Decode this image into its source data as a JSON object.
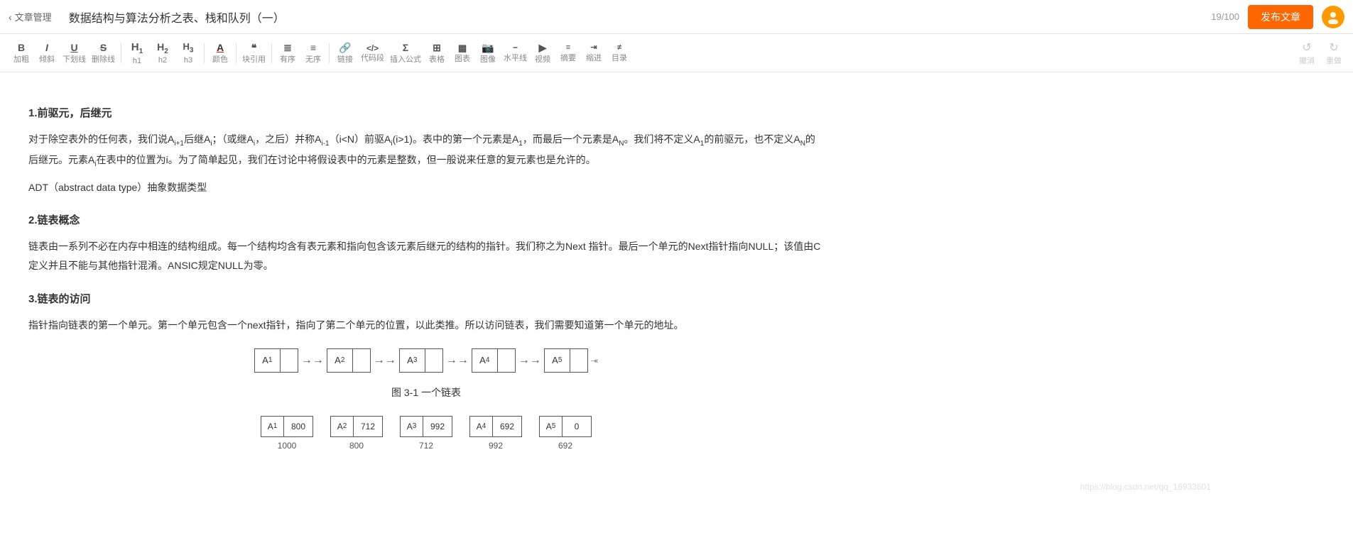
{
  "header": {
    "back_label": "文章管理",
    "title": "数据结构与算法分析之表、栈和队列（一）",
    "word_count": "19/100",
    "publish_label": "发布文章",
    "avatar_icon": "👤"
  },
  "toolbar": {
    "buttons": [
      {
        "id": "bold",
        "icon": "B",
        "label": "加粗",
        "style": "bold"
      },
      {
        "id": "italic",
        "icon": "I",
        "label": "倾斜",
        "style": "italic"
      },
      {
        "id": "underline",
        "icon": "U",
        "label": "下划线",
        "style": "underline"
      },
      {
        "id": "strikethrough",
        "icon": "S",
        "label": "删除线",
        "style": "strikethrough"
      },
      {
        "id": "h1",
        "icon": "H₁",
        "label": "h1",
        "style": "normal"
      },
      {
        "id": "h2",
        "icon": "H₂",
        "label": "h2",
        "style": "normal"
      },
      {
        "id": "h3",
        "icon": "H₃",
        "label": "h3",
        "style": "normal"
      },
      {
        "id": "color",
        "icon": "A",
        "label": "颜色",
        "style": "normal"
      },
      {
        "id": "blockquote",
        "icon": "❝",
        "label": "块引用",
        "style": "normal"
      },
      {
        "id": "ordered",
        "icon": "≡",
        "label": "有序",
        "style": "normal"
      },
      {
        "id": "unordered",
        "icon": "≡",
        "label": "无序",
        "style": "normal"
      },
      {
        "id": "link",
        "icon": "🔗",
        "label": "链接",
        "style": "normal"
      },
      {
        "id": "code",
        "icon": "</>",
        "label": "代码段",
        "style": "normal"
      },
      {
        "id": "formula",
        "icon": "Σ",
        "label": "插入公式",
        "style": "normal"
      },
      {
        "id": "table",
        "icon": "⊞",
        "label": "表格",
        "style": "normal"
      },
      {
        "id": "chart",
        "icon": "📊",
        "label": "图表",
        "style": "normal"
      },
      {
        "id": "image",
        "icon": "🖼",
        "label": "图像",
        "style": "normal"
      },
      {
        "id": "divider",
        "icon": "—",
        "label": "水平线",
        "style": "normal"
      },
      {
        "id": "video",
        "icon": "▶",
        "label": "视频",
        "style": "normal"
      },
      {
        "id": "summary",
        "icon": "≡",
        "label": "摘要",
        "style": "normal"
      },
      {
        "id": "indent",
        "icon": "→≡",
        "label": "缩进",
        "style": "normal"
      },
      {
        "id": "toc",
        "icon": "≡",
        "label": "目录",
        "style": "normal"
      }
    ],
    "undo_label": "撤消",
    "redo_label": "重做"
  },
  "content": {
    "section1_heading": "1.前驱元，后继元",
    "section1_para1": "对于除空表外的任何表，我们说Ai+1后继Ai；（或继Ai，之后）并称Ai-1（i<N）前驱Ai(i>1)。表中的第一个元素是A1，而最后一个元素是AN。我们将不定义A1的前驱元，也不定义AN的后继元。元素Ai在表中的位置为i。为了简单起见，我们在讨论中将假设表中的元素是整数，但一般说来任意的复元素也是允许的。",
    "section1_para2": "ADT（abstract data type）抽象数据类型",
    "section2_heading": "2.链表概念",
    "section2_para": "链表由一系列不必在内存中相连的结构组成。每一个结构均含有表元素和指向包含该元素后继元的结构的指针。我们称之为Next 指针。最后一个单元的Next指针指向NULL；该值由C定义并且不能与其他指针混淆。ANSIC规定NULL为零。",
    "section3_heading": "3.链表的访问",
    "section3_para": "指针指向链表的第一个单元。第一个单元包含一个next指针，指向了第二个单元的位置，以此类推。所以访问链表，我们需要知道第一个单元的地址。",
    "diagram_caption": "图 3-1   一个链表",
    "linked_list_nodes": [
      "A₁",
      "A₂",
      "A₃",
      "A₄",
      "A₅"
    ],
    "memory_nodes": [
      {
        "label": "A₁",
        "addr": "800",
        "base": "1000"
      },
      {
        "label": "A₂",
        "addr": "712",
        "base": "800"
      },
      {
        "label": "A₃",
        "addr": "992",
        "base": "712"
      },
      {
        "label": "A₄",
        "addr": "692",
        "base": "992"
      },
      {
        "label": "A₅",
        "addr": "0",
        "base": "692"
      }
    ],
    "watermark": "https://blog.csdn.net/qq_16933601"
  },
  "colors": {
    "publish_btn": "#ff6600",
    "header_border": "#e0e0e0",
    "toolbar_border": "#e8e8e8",
    "text_primary": "#333",
    "text_muted": "#999",
    "avatar_bg": "#ff9900"
  }
}
